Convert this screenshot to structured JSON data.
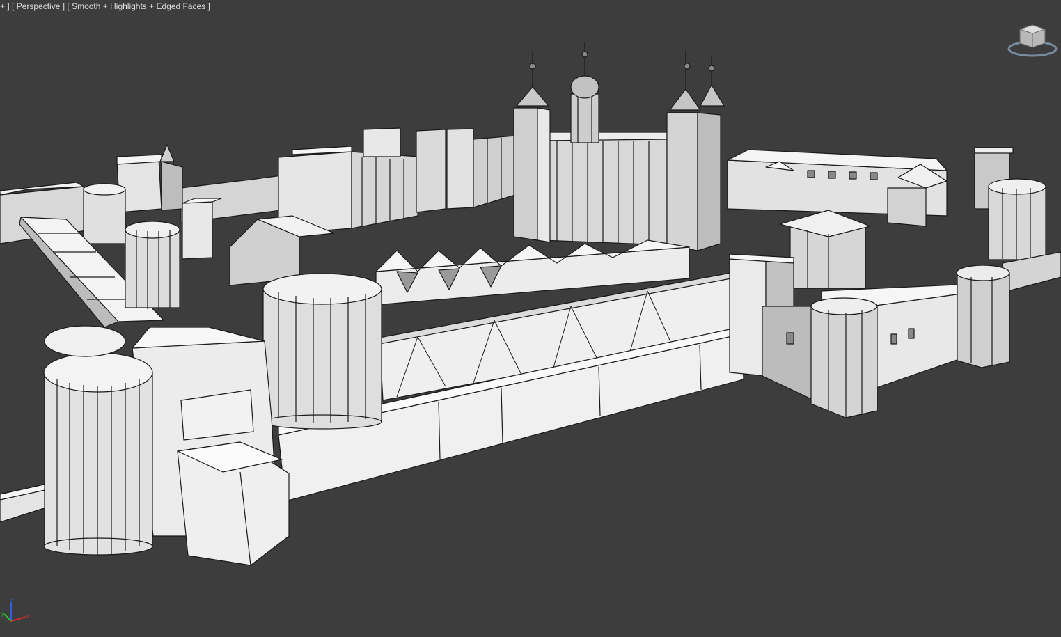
{
  "viewport": {
    "menu_label": "+ ]",
    "view_label": "[ Perspective ]",
    "shading_label": "[ Smooth + Highlights + Edged Faces ]"
  },
  "scene": {
    "description_icon": "castle-model",
    "background_color": "#3d3d3d",
    "model_color": "#e8e8e8",
    "edge_color": "#1a1a1a"
  },
  "viewcube": {
    "icon": "viewcube-icon"
  },
  "axis_tripod": {
    "x_label": "x",
    "y_label": "y",
    "z_label": "z",
    "x_color": "#d03030",
    "y_color": "#30c030",
    "z_color": "#3060e0"
  }
}
